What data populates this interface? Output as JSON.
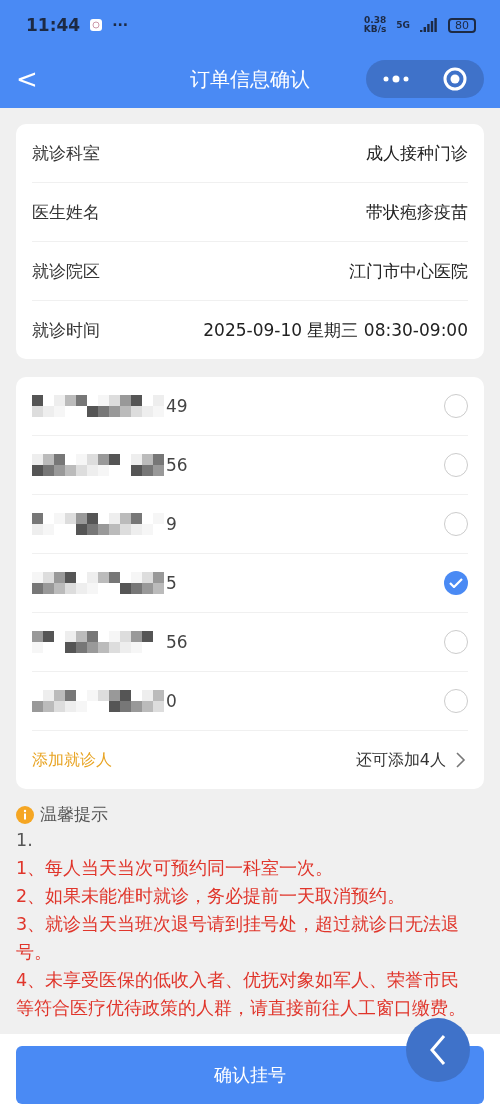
{
  "status_bar": {
    "time": "11:44",
    "more": "···",
    "speed_value": "0.38",
    "speed_unit": "KB/s",
    "network": "5G",
    "battery": "80"
  },
  "nav": {
    "back": "<",
    "title": "订单信息确认"
  },
  "visit_info": [
    {
      "label": "就诊科室",
      "value": "成人接种门诊"
    },
    {
      "label": "医生姓名",
      "value": "带状疱疹疫苗"
    },
    {
      "label": "就诊院区",
      "value": "江门市中心医院"
    },
    {
      "label": "就诊时间",
      "value": "2025-09-10 星期三 08:30-09:00"
    }
  ],
  "patients": [
    {
      "visible_text": "49",
      "selected": false
    },
    {
      "visible_text": "56",
      "selected": false
    },
    {
      "visible_text": "9",
      "selected": false
    },
    {
      "visible_text": "5",
      "selected": true
    },
    {
      "visible_text": "56",
      "selected": false
    },
    {
      "visible_text": "0",
      "selected": false
    }
  ],
  "add_patient": {
    "label": "添加就诊人",
    "remaining": "还可添加4人"
  },
  "tips": {
    "title": "温馨提示",
    "lines": [
      "1.",
      "1、每人当天当次可预约同一科室一次。",
      "2、如果未能准时就诊，务必提前一天取消预约。",
      "3、就诊当天当班次退号请到挂号处，超过就诊日无法退号。",
      "4、未享受医保的低收入者、优抚对象如军人、荣誉市民等符合医疗优待政策的人群，请直接前往人工窗口缴费。"
    ]
  },
  "confirm_button": "确认挂号"
}
